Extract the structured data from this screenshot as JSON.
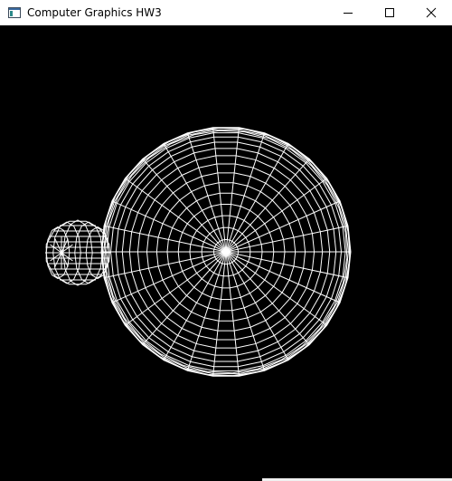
{
  "window": {
    "title": "Computer Graphics HW3",
    "controls": {
      "minimize_icon": "minimize-icon",
      "maximize_icon": "maximize-icon",
      "close_icon": "close-icon"
    }
  },
  "canvas": {
    "background": "#000000",
    "wire_color": "#ffffff"
  }
}
